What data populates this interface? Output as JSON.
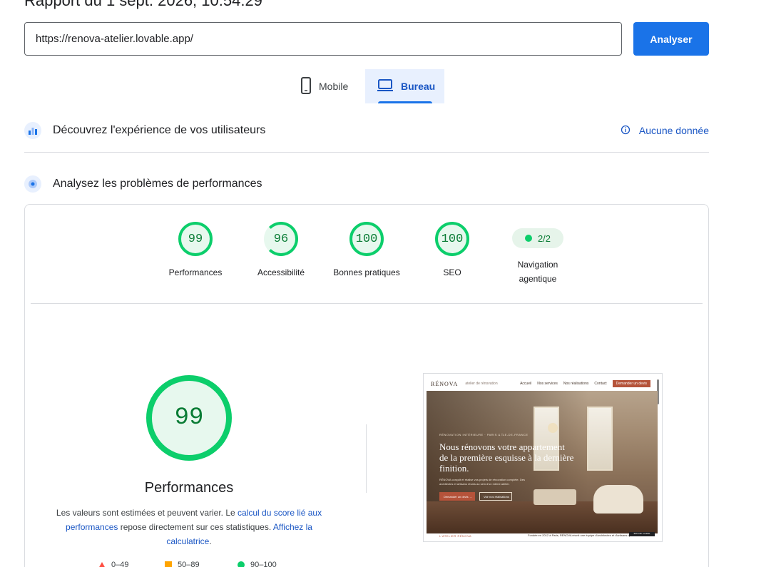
{
  "report": {
    "title": "Rapport du 1 sept. 2026, 10:54:29"
  },
  "search": {
    "url_value": "https://renova-atelier.lovable.app/",
    "analyze_label": "Analyser"
  },
  "tabs": [
    {
      "label": "Mobile",
      "icon": "smartphone-icon",
      "selected": false
    },
    {
      "label": "Bureau",
      "icon": "laptop-icon",
      "selected": true
    }
  ],
  "field_data": {
    "title": "Découvrez l'expérience de vos utilisateurs",
    "link_label": "Aucune donnée",
    "link_icon": "info-icon"
  },
  "lab_data": {
    "title": "Analysez les problèmes de performances"
  },
  "scores": [
    {
      "label": "Performances",
      "value": "99"
    },
    {
      "label": "Accessibilité",
      "value": "96"
    },
    {
      "label": "Bonnes pratiques",
      "value": "100"
    },
    {
      "label": "SEO",
      "value": "100"
    }
  ],
  "agentic": {
    "value": "2/2",
    "label_line1": "Navigation",
    "label_line2": "agentique"
  },
  "performance": {
    "score": "99",
    "label": "Performances",
    "disclaimer_1": "Les valeurs sont estimées et peuvent varier. Le ",
    "link_1": "calcul du score lié aux performances",
    "disclaimer_2": " repose directement sur ces statistiques. ",
    "link_2": "Affichez la calculatrice",
    "disclaimer_3": "."
  },
  "legend": [
    {
      "label": "0–49",
      "color": "#ff4e42"
    },
    {
      "label": "50–89",
      "color": "#ffa400"
    },
    {
      "label": "90–100",
      "color": "#0cce6b"
    }
  ],
  "thumbnail": {
    "brand": "RÉNOVA",
    "brand_sub": "atelier de rénovation",
    "nav": [
      "Accueil",
      "Nos services",
      "Nos réalisations",
      "Contact"
    ],
    "cta": "Demander un devis",
    "kicker": "RÉNOVATION INTÉRIEURE · PARIS & ÎLE-DE-FRANCE",
    "heading": "Nous rénovons votre appartement de la première esquisse à la dernière finition.",
    "description": "RÉNOVA conçoit et réalise vos projets de rénovation complète. Des architectes et artisans réunis au sein d'un même atelier.",
    "button_primary": "Demander un devis →",
    "button_secondary": "Voir nos réalisations",
    "footer_left": "L'ATELIER RÉNOVA",
    "footer_right": "Fondée en 2012 à Paris, RÉNOVA réunit une équipe d'architectes et d'artisans qui",
    "badge": "Edit with Lovable"
  },
  "colors": {
    "accent": "#1a73e8",
    "pass": "#0cce6b",
    "average": "#ffa400",
    "fail": "#ff4e42"
  }
}
